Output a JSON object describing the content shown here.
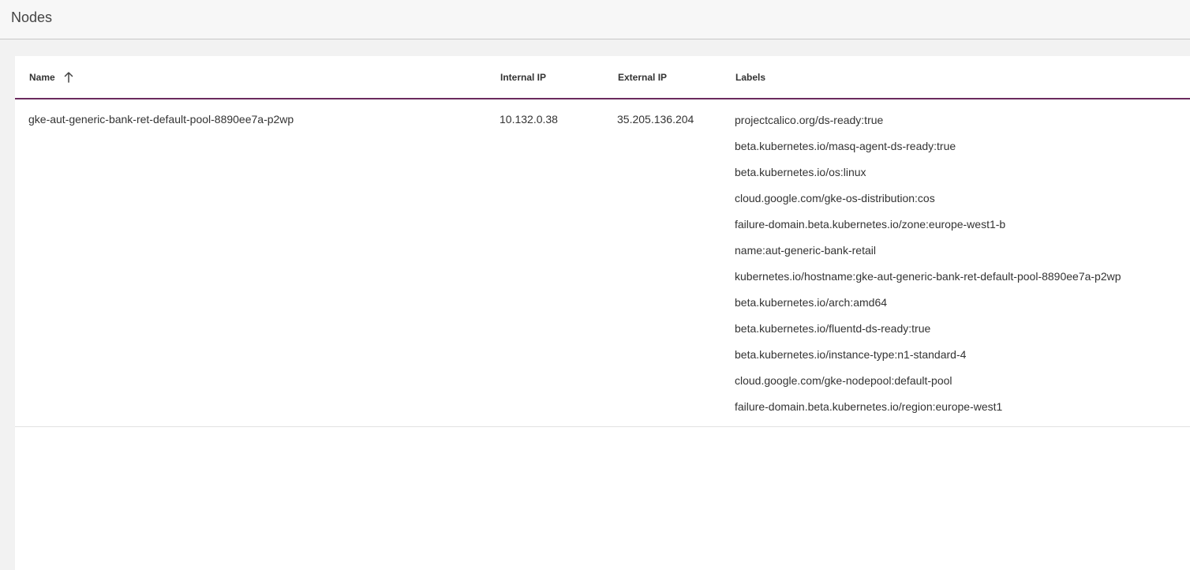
{
  "header": {
    "title": "Nodes"
  },
  "table": {
    "columns": {
      "name": "Name",
      "internal_ip": "Internal IP",
      "external_ip": "External IP",
      "labels": "Labels"
    },
    "sort": {
      "column": "name",
      "direction": "ascending",
      "icon": "arrow-up-icon"
    },
    "rows": [
      {
        "name": "gke-aut-generic-bank-ret-default-pool-8890ee7a-p2wp",
        "internal_ip": "10.132.0.38",
        "external_ip": "35.205.136.204",
        "labels": [
          "projectcalico.org/ds-ready:true",
          "beta.kubernetes.io/masq-agent-ds-ready:true",
          "beta.kubernetes.io/os:linux",
          "cloud.google.com/gke-os-distribution:cos",
          "failure-domain.beta.kubernetes.io/zone:europe-west1-b",
          "name:aut-generic-bank-retail",
          "kubernetes.io/hostname:gke-aut-generic-bank-ret-default-pool-8890ee7a-p2wp",
          "beta.kubernetes.io/arch:amd64",
          "beta.kubernetes.io/fluentd-ds-ready:true",
          "beta.kubernetes.io/instance-type:n1-standard-4",
          "cloud.google.com/gke-nodepool:default-pool",
          "failure-domain.beta.kubernetes.io/region:europe-west1"
        ]
      }
    ]
  },
  "colors": {
    "accent": "#6b2a5e",
    "background": "#f2f2f2",
    "card": "#ffffff",
    "text": "#333333"
  }
}
